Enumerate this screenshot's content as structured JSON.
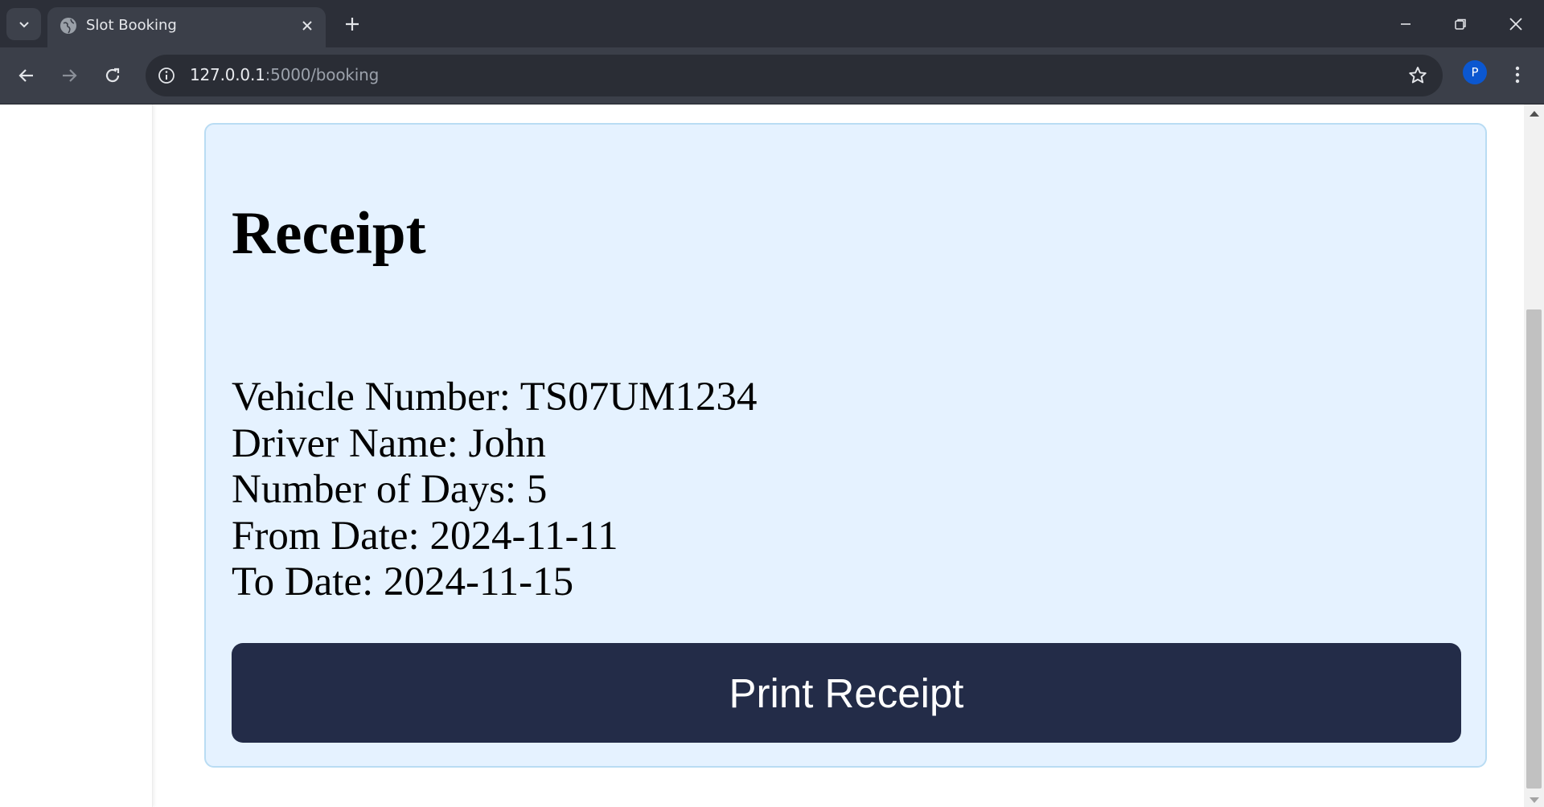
{
  "browser": {
    "tab_title": "Slot Booking",
    "url_host": "127.0.0.1",
    "url_path": ":5000/booking",
    "profile_initial": "P",
    "accent_color": "#0b57d0"
  },
  "receipt": {
    "title": "Receipt",
    "details": [
      "Vehicle Number: TS07UM1234",
      "Driver Name: John",
      "Number of Days: 5",
      "From Date: 2024-11-11",
      "To Date: 2024-11-15"
    ],
    "print_button_label": "Print Receipt",
    "card_background": "#e5f2ff",
    "button_background": "#232c48"
  },
  "icons": {
    "tab_list": "chevron-down-icon",
    "favicon": "globe-icon",
    "tab_close": "close-icon",
    "new_tab": "plus-icon",
    "minimize": "minimize-icon",
    "restore": "restore-icon",
    "close_window": "close-icon",
    "back": "arrow-left-icon",
    "forward": "arrow-right-icon",
    "reload": "reload-icon",
    "site_info": "info-icon",
    "bookmark": "star-icon",
    "menu": "more-vertical-icon"
  }
}
